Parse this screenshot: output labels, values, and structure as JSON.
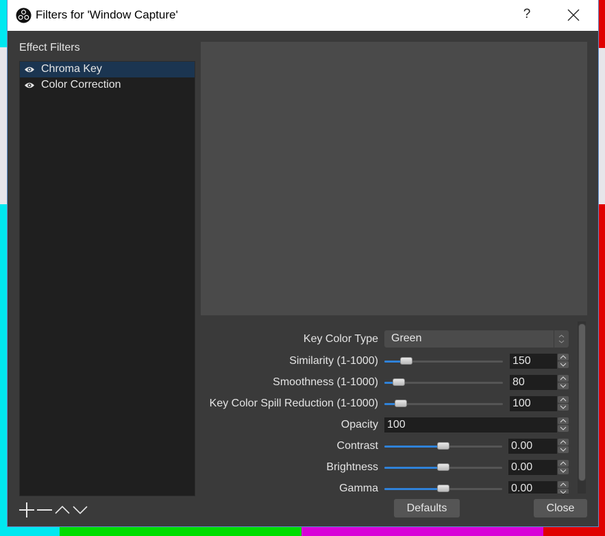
{
  "window": {
    "title": "Filters for 'Window Capture'",
    "help_label": "?",
    "app_icon": "obs-logo-icon",
    "close_icon": "close-icon"
  },
  "sidebar": {
    "heading": "Effect Filters",
    "filters": [
      {
        "name": "Chroma Key",
        "visible": true,
        "selected": true,
        "icon": "eye-icon"
      },
      {
        "name": "Color Correction",
        "visible": true,
        "selected": false,
        "icon": "eye-icon"
      }
    ],
    "toolbar": [
      {
        "action": "add",
        "icon": "plus-icon"
      },
      {
        "action": "remove",
        "icon": "minus-icon"
      },
      {
        "action": "move-up",
        "icon": "chevron-up-icon"
      },
      {
        "action": "move-down",
        "icon": "chevron-down-icon"
      }
    ]
  },
  "properties": {
    "key_color_type": {
      "label": "Key Color Type",
      "value": "Green"
    },
    "similarity": {
      "label": "Similarity (1-1000)",
      "value": "150",
      "fraction": 0.149
    },
    "smoothness": {
      "label": "Smoothness (1-1000)",
      "value": "80",
      "fraction": 0.079
    },
    "spill": {
      "label": "Key Color Spill Reduction (1-1000)",
      "value": "100",
      "fraction": 0.099
    },
    "opacity": {
      "label": "Opacity",
      "value": "100"
    },
    "contrast": {
      "label": "Contrast",
      "value": "0.00",
      "fraction": 0.5
    },
    "brightness": {
      "label": "Brightness",
      "value": "0.00",
      "fraction": 0.5
    },
    "gamma": {
      "label": "Gamma",
      "value": "0.00",
      "fraction": 0.5
    }
  },
  "buttons": {
    "defaults": "Defaults",
    "close": "Close"
  },
  "colors": {
    "accent": "#2f82d9",
    "selection": "#1b3551",
    "window_bg": "#3a3a3a",
    "preview_bg": "#4a4a4a",
    "backdrop_cyan": "#00e8f0",
    "backdrop_green": "#00dc00",
    "backdrop_magenta": "#d800d8",
    "backdrop_red": "#e00000"
  }
}
